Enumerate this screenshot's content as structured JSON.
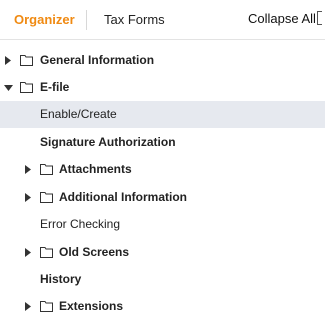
{
  "tabs": {
    "organizer": "Organizer",
    "tax_forms": "Tax Forms"
  },
  "toolbar": {
    "collapse_all": "Collapse All"
  },
  "colors": {
    "active_tab": "#f08a12",
    "selected_row": "#e6e9ef"
  },
  "tree": [
    {
      "label": "General Information",
      "bold": true,
      "expandable": true,
      "expanded": false,
      "folder": true
    },
    {
      "label": "E-file",
      "bold": true,
      "expandable": true,
      "expanded": true,
      "folder": true
    },
    {
      "label": "Enable/Create",
      "bold": false,
      "selected": true
    },
    {
      "label": "Signature Authorization",
      "bold": true
    },
    {
      "label": "Attachments",
      "bold": true,
      "expandable": true,
      "expanded": false,
      "folder": true
    },
    {
      "label": "Additional Information",
      "bold": true,
      "expandable": true,
      "expanded": false,
      "folder": true
    },
    {
      "label": "Error Checking",
      "bold": false
    },
    {
      "label": "Old Screens",
      "bold": true,
      "expandable": true,
      "expanded": false,
      "folder": true
    },
    {
      "label": "History",
      "bold": true
    },
    {
      "label": "Extensions",
      "bold": true,
      "expandable": true,
      "expanded": false,
      "folder": true
    }
  ]
}
